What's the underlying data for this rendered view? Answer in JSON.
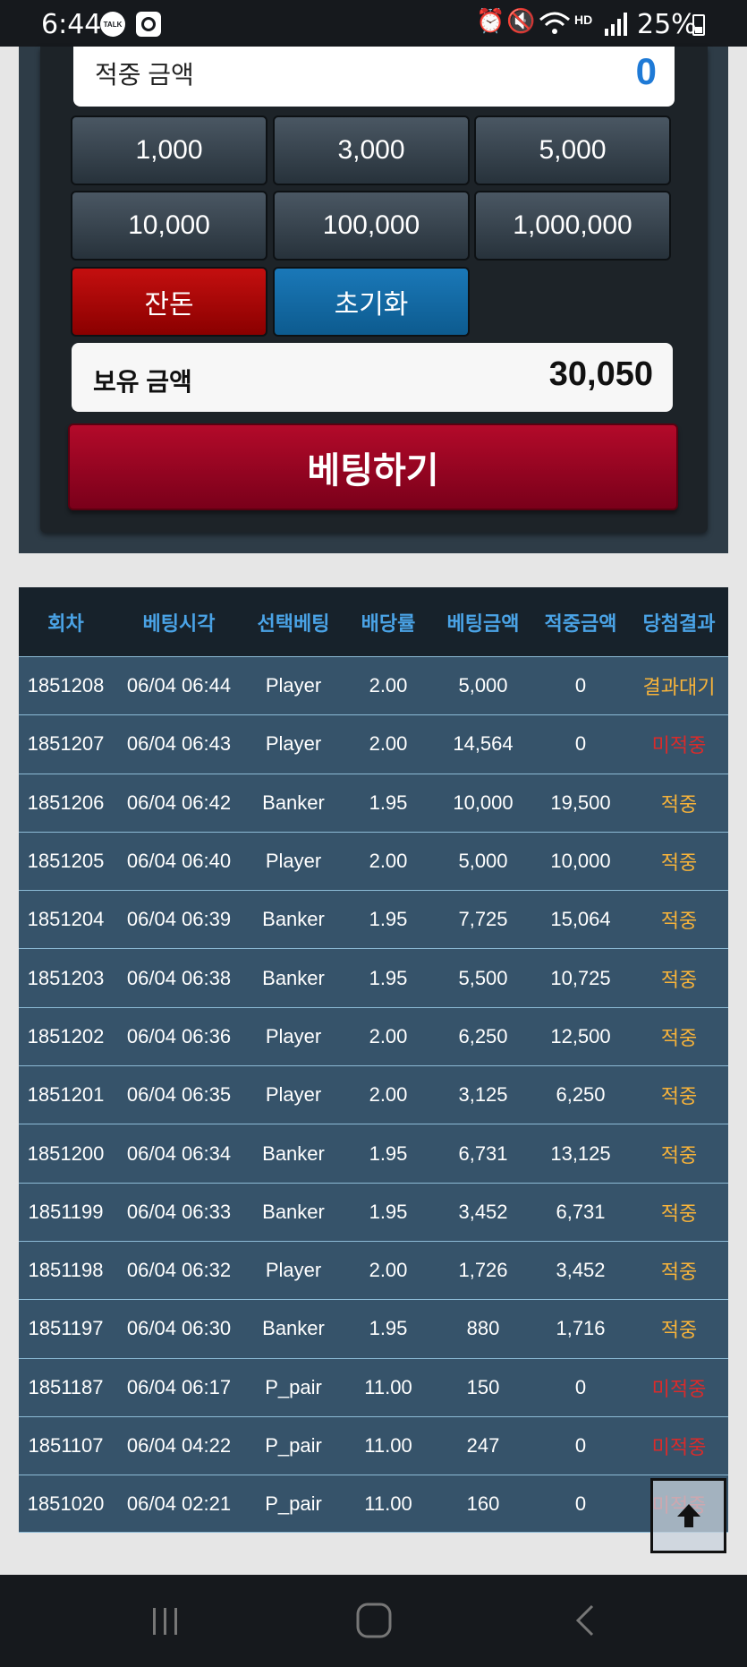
{
  "status_bar": {
    "time": "6:44",
    "talk_icon": "TALK",
    "battery": "25%"
  },
  "bet_panel": {
    "hit_amount_label": "적중 금액",
    "hit_amount_value": "0",
    "chips": [
      "1,000",
      "3,000",
      "5,000",
      "10,000",
      "100,000",
      "1,000,000"
    ],
    "balance_button": "잔돈",
    "reset_button": "초기화",
    "owned_label": "보유 금액",
    "owned_value": "30,050",
    "bet_button": "베팅하기"
  },
  "history_table": {
    "headers": [
      "회차",
      "베팅시각",
      "선택베팅",
      "배당률",
      "베팅금액",
      "적중금액",
      "당첨결과"
    ],
    "rows": [
      [
        "1851208",
        "06/04 06:44",
        "Player",
        "2.00",
        "5,000",
        "0",
        "결과대기"
      ],
      [
        "1851207",
        "06/04 06:43",
        "Player",
        "2.00",
        "14,564",
        "0",
        "미적중"
      ],
      [
        "1851206",
        "06/04 06:42",
        "Banker",
        "1.95",
        "10,000",
        "19,500",
        "적중"
      ],
      [
        "1851205",
        "06/04 06:40",
        "Player",
        "2.00",
        "5,000",
        "10,000",
        "적중"
      ],
      [
        "1851204",
        "06/04 06:39",
        "Banker",
        "1.95",
        "7,725",
        "15,064",
        "적중"
      ],
      [
        "1851203",
        "06/04 06:38",
        "Banker",
        "1.95",
        "5,500",
        "10,725",
        "적중"
      ],
      [
        "1851202",
        "06/04 06:36",
        "Player",
        "2.00",
        "6,250",
        "12,500",
        "적중"
      ],
      [
        "1851201",
        "06/04 06:35",
        "Player",
        "2.00",
        "3,125",
        "6,250",
        "적중"
      ],
      [
        "1851200",
        "06/04 06:34",
        "Banker",
        "1.95",
        "6,731",
        "13,125",
        "적중"
      ],
      [
        "1851199",
        "06/04 06:33",
        "Banker",
        "1.95",
        "3,452",
        "6,731",
        "적중"
      ],
      [
        "1851198",
        "06/04 06:32",
        "Player",
        "2.00",
        "1,726",
        "3,452",
        "적중"
      ],
      [
        "1851197",
        "06/04 06:30",
        "Banker",
        "1.95",
        "880",
        "1,716",
        "적중"
      ],
      [
        "1851187",
        "06/04 06:17",
        "P_pair",
        "11.00",
        "150",
        "0",
        "미적중"
      ],
      [
        "1851107",
        "06/04 04:22",
        "P_pair",
        "11.00",
        "247",
        "0",
        "미적중"
      ],
      [
        "1851020",
        "06/04 02:21",
        "P_pair",
        "11.00",
        "160",
        "0",
        "미적중"
      ]
    ]
  },
  "icons": {
    "scroll_top": "arrow-up-icon",
    "nav_recent": "recent-apps-icon",
    "nav_home": "home-icon",
    "nav_back": "back-icon"
  },
  "colors": {
    "result_wait": "#f7b33a",
    "result_hit": "#f7b33a",
    "result_miss": "#d92b2b",
    "header_text": "#4aa3e6",
    "hit_value": "#1f7ad6"
  }
}
